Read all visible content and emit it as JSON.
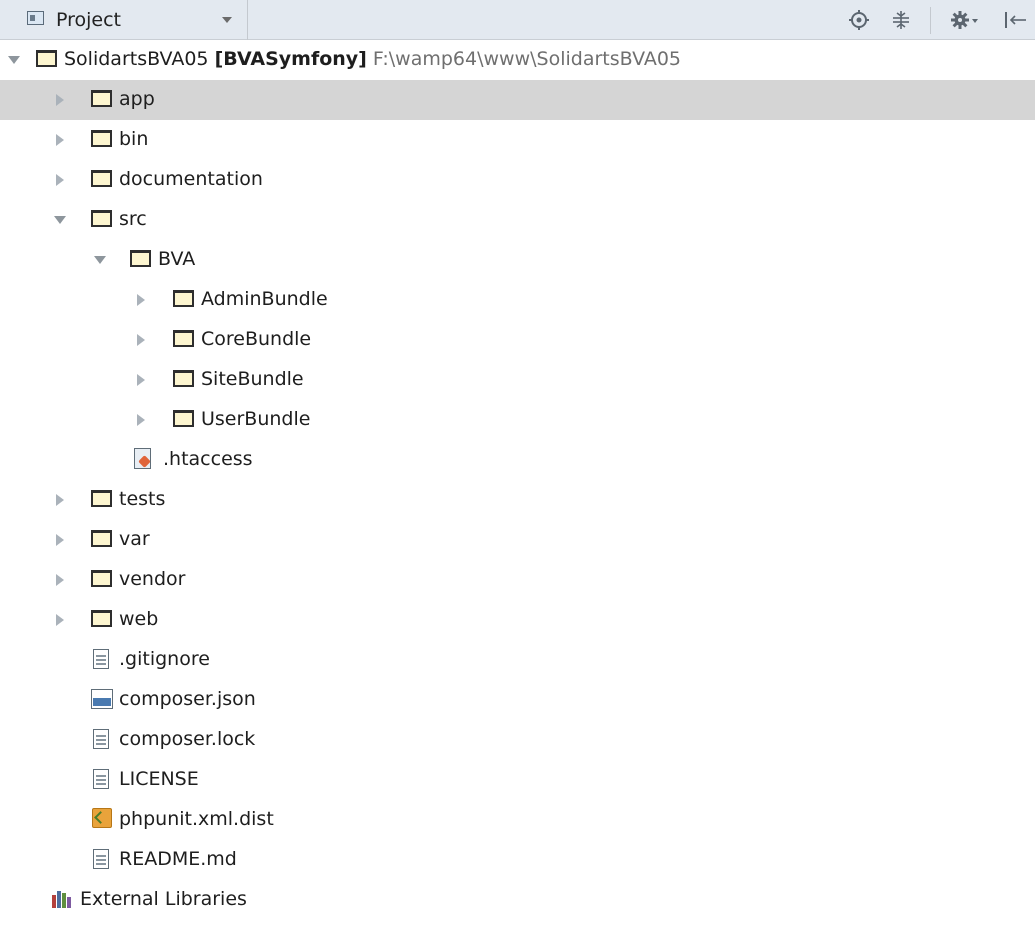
{
  "header": {
    "view_label": "Project",
    "tool_icons": [
      "locate-icon",
      "collapse-all-icon",
      "settings-icon",
      "hide-icon"
    ]
  },
  "tree": {
    "root": {
      "name": "SolidartsBVA05",
      "module": "[BVASymfony]",
      "path": "F:\\wamp64\\www\\SolidartsBVA05"
    },
    "items": [
      {
        "label": "app",
        "type": "folder",
        "expanded": false,
        "selected": true
      },
      {
        "label": "bin",
        "type": "folder",
        "expanded": false
      },
      {
        "label": "documentation",
        "type": "folder",
        "expanded": false
      },
      {
        "label": "src",
        "type": "folder",
        "expanded": true
      },
      {
        "label": "BVA",
        "type": "folder",
        "expanded": true
      },
      {
        "label": "AdminBundle",
        "type": "folder",
        "expanded": false
      },
      {
        "label": "CoreBundle",
        "type": "folder",
        "expanded": false
      },
      {
        "label": "SiteBundle",
        "type": "folder",
        "expanded": false
      },
      {
        "label": "UserBundle",
        "type": "folder",
        "expanded": false
      },
      {
        "label": ".htaccess",
        "type": "htaccess-file"
      },
      {
        "label": "tests",
        "type": "folder",
        "expanded": false
      },
      {
        "label": "var",
        "type": "folder",
        "expanded": false
      },
      {
        "label": "vendor",
        "type": "folder",
        "expanded": false
      },
      {
        "label": "web",
        "type": "folder",
        "expanded": false
      },
      {
        "label": ".gitignore",
        "type": "text-file"
      },
      {
        "label": "composer.json",
        "type": "json-file"
      },
      {
        "label": "composer.lock",
        "type": "text-file"
      },
      {
        "label": "LICENSE",
        "type": "text-file"
      },
      {
        "label": "phpunit.xml.dist",
        "type": "xml-file"
      },
      {
        "label": "README.md",
        "type": "text-file"
      }
    ],
    "external_libraries": "External Libraries"
  },
  "colors": {
    "header_bg": "#e3e9f0",
    "selected_row": "#d5d5d5",
    "folder_fill": "#fdf6d0",
    "path_text": "#6f6f6f"
  }
}
